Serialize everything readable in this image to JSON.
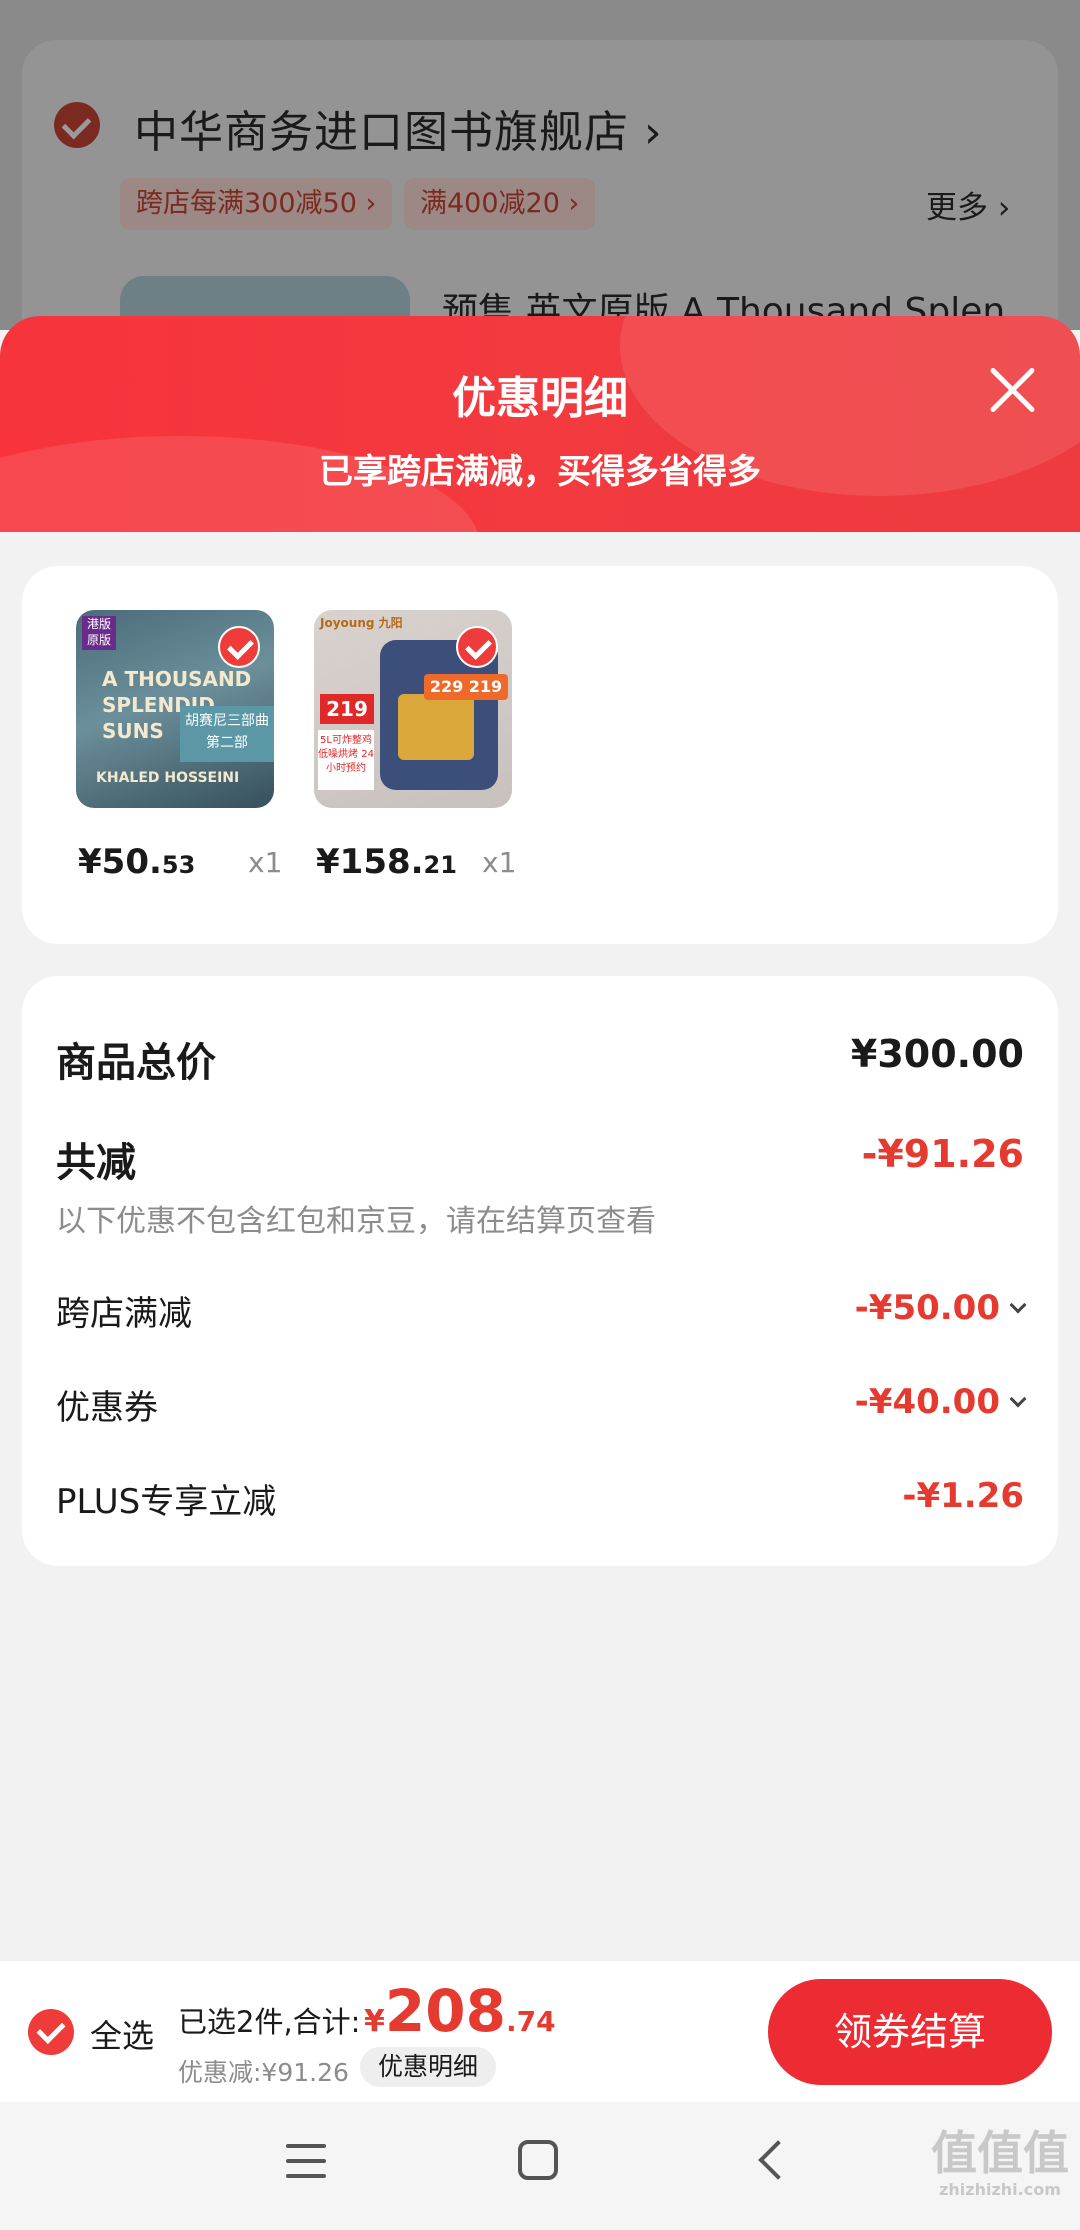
{
  "background": {
    "store_name": "中华商务进口图书旗舰店 ›",
    "promo_1": "跨店每满300减50 ›",
    "promo_2": "满400减20 ›",
    "more": "更多 ›",
    "product_title": "预售 英文原版 A Thousand Splen"
  },
  "sheet": {
    "title": "优惠明细",
    "subtitle": "已享跨店满减，买得多省得多"
  },
  "products": [
    {
      "price_int": "¥50.",
      "price_dec": "53",
      "qty": "x1",
      "cover": {
        "title": "A THOUSAND SPLENDID SUNS",
        "band": "胡赛尼三部曲 第二部",
        "author": "KHALED HOSSEINI",
        "badge": "港版原版"
      }
    },
    {
      "price_int": "¥158.",
      "price_dec": "21",
      "qty": "x1",
      "cover": {
        "brand": "Joyoung 九阳",
        "price": "219",
        "banner": "229 219",
        "tag": "5L可炸整鸡 低噪烘烤 24小时预约"
      }
    }
  ],
  "summary": {
    "total_label": "商品总价",
    "total_value": "¥300.00",
    "discount_label": "共减",
    "discount_value": "-¥91.26",
    "note": "以下优惠不包含红包和京豆，请在结算页查看",
    "items": [
      {
        "label": "跨店满减",
        "value": "-¥50.00"
      },
      {
        "label": "优惠券",
        "value": "-¥40.00"
      },
      {
        "label": "PLUS专享立减",
        "value": "-¥1.26"
      }
    ]
  },
  "bottom": {
    "select_all": "全选",
    "selected": "已选2件,合计:",
    "total_currency": "¥",
    "total_int": "208",
    "total_dec": ".74",
    "saved": "优惠减:¥91.26",
    "detail_button": "优惠明细",
    "checkout_button": "领券结算"
  },
  "watermark": {
    "line1": "值值值",
    "line2": "zhizhizhi.com"
  },
  "colors": {
    "accent_red": "#e43a2f",
    "button_red": "#ec2b33",
    "header_red": "#f23a3f"
  }
}
